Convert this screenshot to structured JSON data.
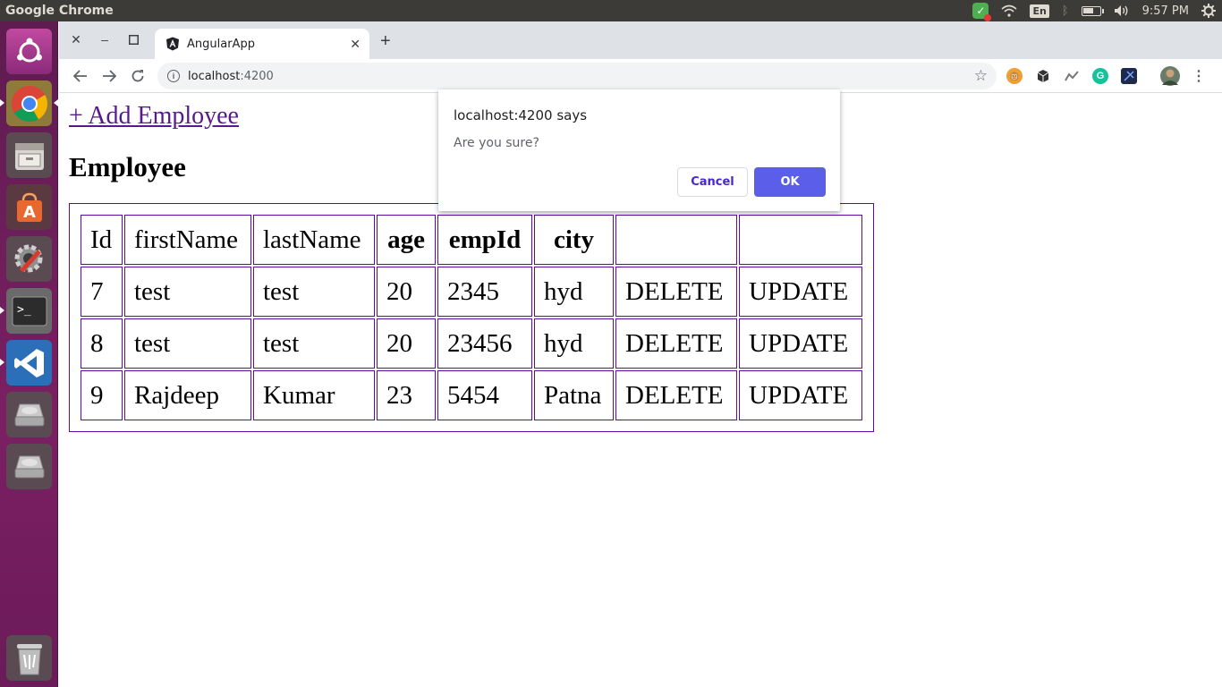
{
  "panel": {
    "app_title": "Google Chrome",
    "lang": "En",
    "clock": "9:57 PM"
  },
  "launcher": {
    "items": [
      {
        "name": "ubuntu-dash-icon"
      },
      {
        "name": "chrome-icon"
      },
      {
        "name": "files-icon"
      },
      {
        "name": "software-center-icon"
      },
      {
        "name": "system-settings-icon"
      },
      {
        "name": "terminal-icon"
      },
      {
        "name": "vscode-icon"
      },
      {
        "name": "drive-icon"
      },
      {
        "name": "drive-icon"
      },
      {
        "name": "trash-icon"
      }
    ]
  },
  "browser": {
    "tab_title": "AngularApp",
    "url_host": "localhost",
    "url_port": ":4200"
  },
  "page": {
    "add_link": "+ Add Employee",
    "heading": "Employee",
    "columns": [
      "Id",
      "firstName",
      "lastName",
      "age",
      "empId",
      "city",
      "",
      ""
    ],
    "rows": [
      [
        "7",
        "test",
        "test",
        "20",
        "2345",
        "hyd",
        "DELETE",
        "UPDATE"
      ],
      [
        "8",
        "test",
        "test",
        "20",
        "23456",
        "hyd",
        "DELETE",
        "UPDATE"
      ],
      [
        "9",
        "Rajdeep",
        "Kumar",
        "23",
        "5454",
        "Patna",
        "DELETE",
        "UPDATE"
      ]
    ]
  },
  "dialog": {
    "title": "localhost:4200 says",
    "message": "Are you sure?",
    "cancel_label": "Cancel",
    "ok_label": "OK"
  },
  "colors": {
    "panel_bg": "#3c3b37",
    "launcher_bg": "#6b1b59",
    "table_border": "#5b0aa3",
    "link": "#551a8b",
    "ok_button": "#5a5ee8"
  }
}
